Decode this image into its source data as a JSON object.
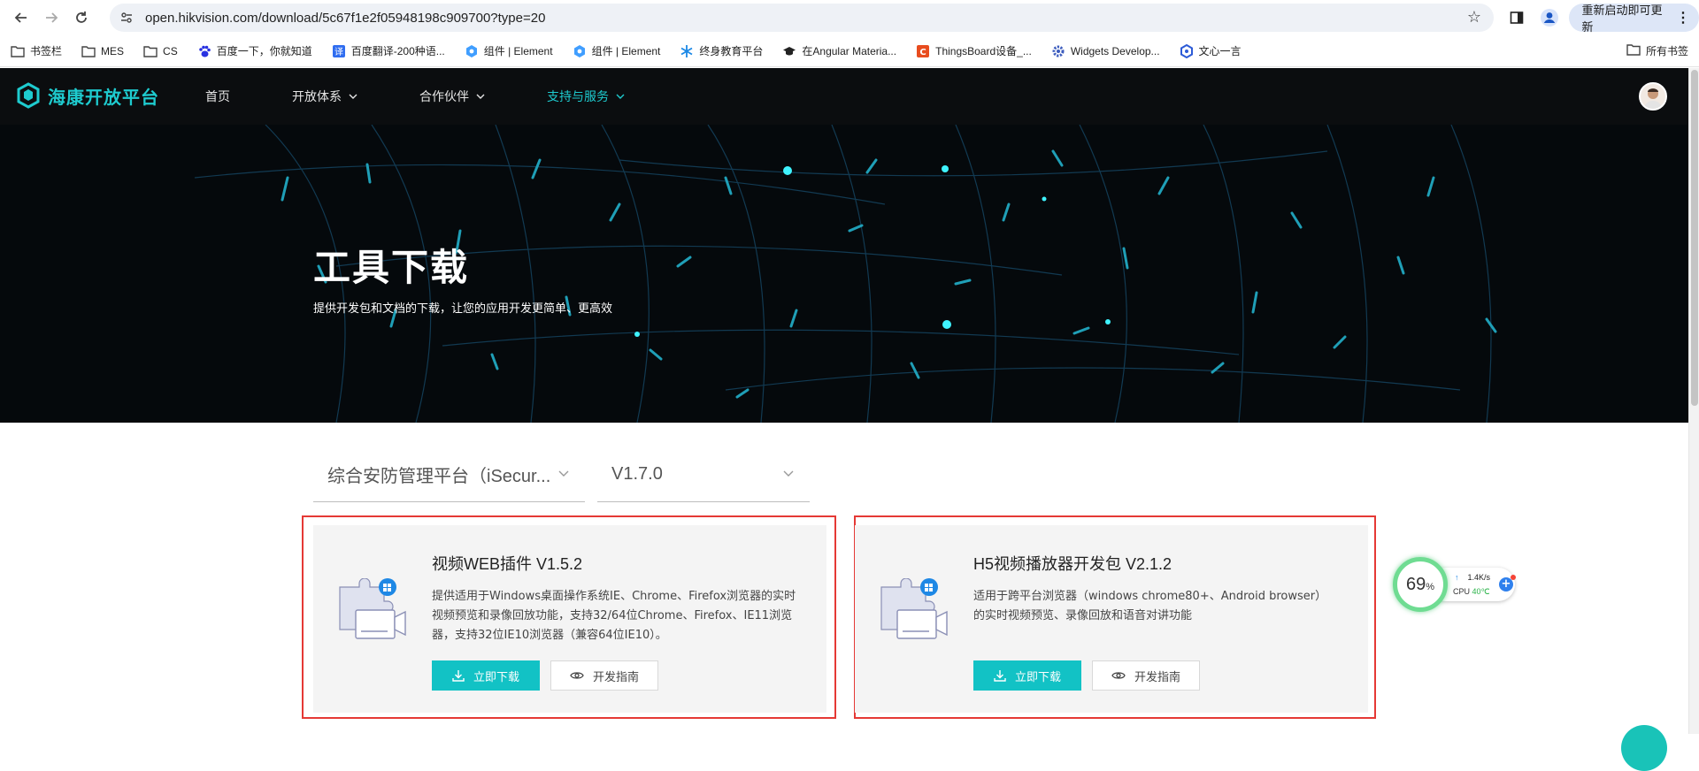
{
  "browser": {
    "url": "open.hikvision.com/download/5c67f1e2f05948198c909700?type=20",
    "update_label": "重新启动即可更新",
    "bookmarks": [
      {
        "label": "书签栏",
        "icon": "folder-icon"
      },
      {
        "label": "MES",
        "icon": "folder-icon"
      },
      {
        "label": "CS",
        "icon": "folder-icon"
      },
      {
        "label": "百度一下，你就知道",
        "icon": "baidu-paw-icon"
      },
      {
        "label": "百度翻译-200种语...",
        "icon": "baidu-translate-icon"
      },
      {
        "label": "组件 | Element",
        "icon": "element-icon"
      },
      {
        "label": "组件 | Element",
        "icon": "element-icon"
      },
      {
        "label": "终身教育平台",
        "icon": "snowflake-icon"
      },
      {
        "label": "在Angular Materia...",
        "icon": "graduation-cap-icon"
      },
      {
        "label": "ThingsBoard设备_...",
        "icon": "csdn-icon"
      },
      {
        "label": "Widgets Develop...",
        "icon": "gear-icon"
      },
      {
        "label": "文心一言",
        "icon": "hexagon-icon"
      }
    ],
    "all_bookmarks_label": "所有书签"
  },
  "site": {
    "logo_text": "海康开放平台",
    "menu": [
      {
        "label": "首页",
        "has_dropdown": false,
        "active": false
      },
      {
        "label": "开放体系",
        "has_dropdown": true,
        "active": false
      },
      {
        "label": "合作伙伴",
        "has_dropdown": true,
        "active": false
      },
      {
        "label": "支持与服务",
        "has_dropdown": true,
        "active": true
      }
    ],
    "accent_color": "#1ecbcf"
  },
  "hero": {
    "title": "工具下载",
    "subtitle": "提供开发包和文档的下载，让您的应用开发更简单、更高效"
  },
  "filters": {
    "platform": "综合安防管理平台（iSecur...",
    "version": "V1.7.0"
  },
  "cards": [
    {
      "title": "视频WEB插件 V1.5.2",
      "description": "提供适用于Windows桌面操作系统IE、Chrome、Firefox浏览器的实时视频预览和录像回放功能，支持32/64位Chrome、Firefox、IE11浏览器，支持32位IE10浏览器（兼容64位IE10）。",
      "download_label": "立即下载",
      "guide_label": "开发指南"
    },
    {
      "title": "H5视频播放器开发包 V2.1.2",
      "description": "适用于跨平台浏览器（windows chrome80+、Android browser）的实时视频预览、录像回放和语音对讲功能",
      "download_label": "立即下载",
      "guide_label": "开发指南"
    }
  ],
  "monitor": {
    "percent": "69",
    "percent_unit": "%",
    "speed": "1.4K/s",
    "cpu_label": "CPU",
    "cpu_temp": "40℃"
  }
}
